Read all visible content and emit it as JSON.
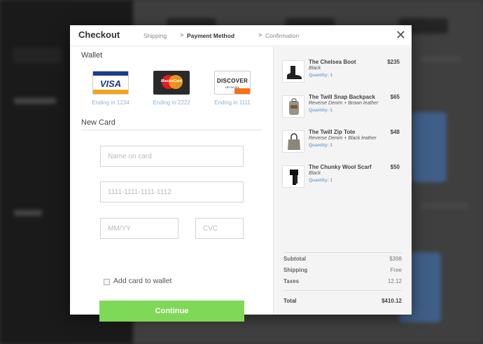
{
  "checkout": {
    "title": "Checkout",
    "steps": [
      "Shipping",
      "Payment Method",
      "Confirmation"
    ],
    "active_step": "Payment Method",
    "close_symbol": "✕"
  },
  "wallet": {
    "title": "Wallet",
    "cards": [
      {
        "brand": "VISA",
        "caption": "Ending in 1234",
        "icon": "visa-card-icon"
      },
      {
        "brand": "MasterCard",
        "caption": "Ending in 2222",
        "icon": "mastercard-card-icon"
      },
      {
        "brand": "DISCOVER",
        "sub": "NETWORK",
        "caption": "Ending in 1111",
        "icon": "discover-card-icon"
      }
    ]
  },
  "new_card": {
    "title": "New Card",
    "name_placeholder": "Name on card",
    "number_placeholder": "1111-1111-1111-1112",
    "expiry_placeholder": "MM/YY",
    "cvc_placeholder": "CVC",
    "add_to_wallet_label": "Add card to wallet",
    "continue_label": "Continue"
  },
  "cart": {
    "items": [
      {
        "name": "The Chelsea Boot",
        "variant": "Black",
        "quantity": "Quantity: 1",
        "price": "$235",
        "icon": "boot-icon"
      },
      {
        "name": "The Twill Snap Backpack",
        "variant": "Reverse Denim + Brown leather",
        "quantity": "Quantity: 1",
        "price": "$65",
        "icon": "backpack-icon"
      },
      {
        "name": "The Twill Zip Tote",
        "variant": "Reverse Denim + Black leather",
        "quantity": "Quantity: 1",
        "price": "$48",
        "icon": "tote-icon"
      },
      {
        "name": "The Chunky Wool Scarf",
        "variant": "Black",
        "quantity": "Quantity: 1",
        "price": "$50",
        "icon": "scarf-icon"
      }
    ],
    "summary": {
      "subtotal_label": "Subtotal",
      "subtotal": "$398",
      "shipping_label": "Shipping",
      "shipping": "Free",
      "taxes_label": "Taxes",
      "taxes": "12.12",
      "total_label": "Total",
      "total": "$410.12"
    }
  },
  "colors": {
    "continue_button": "#7ed957",
    "card_caption": "#8fb3d9",
    "quantity_text": "#7aa4cf"
  }
}
